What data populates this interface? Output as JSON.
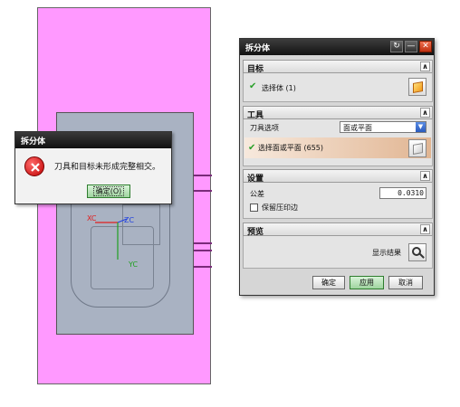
{
  "viewport": {
    "axes": {
      "xc": "XC",
      "zc": "ZC",
      "yc": "YC"
    }
  },
  "error_dialog": {
    "title": "拆分体",
    "message": "刀具和目标未形成完整相交。",
    "ok_label": "确定(O)"
  },
  "split_dialog": {
    "title": "拆分体",
    "title_buttons": {
      "reset": "↻",
      "minimize": "—",
      "close": "✕"
    },
    "target": {
      "header": "目标",
      "select_body": "选择体 (1)"
    },
    "tool": {
      "header": "工具",
      "option_label": "刀具选项",
      "option_value": "面或平面",
      "select_face": "选择面或平面 (655)"
    },
    "settings": {
      "header": "设置",
      "tolerance_label": "公差",
      "tolerance_value": "0.0310",
      "keep_imprint_label": "保留压印边"
    },
    "preview": {
      "header": "预览",
      "show_result": "显示结果"
    },
    "buttons": {
      "ok": "确定",
      "apply": "应用",
      "cancel": "取消"
    }
  }
}
